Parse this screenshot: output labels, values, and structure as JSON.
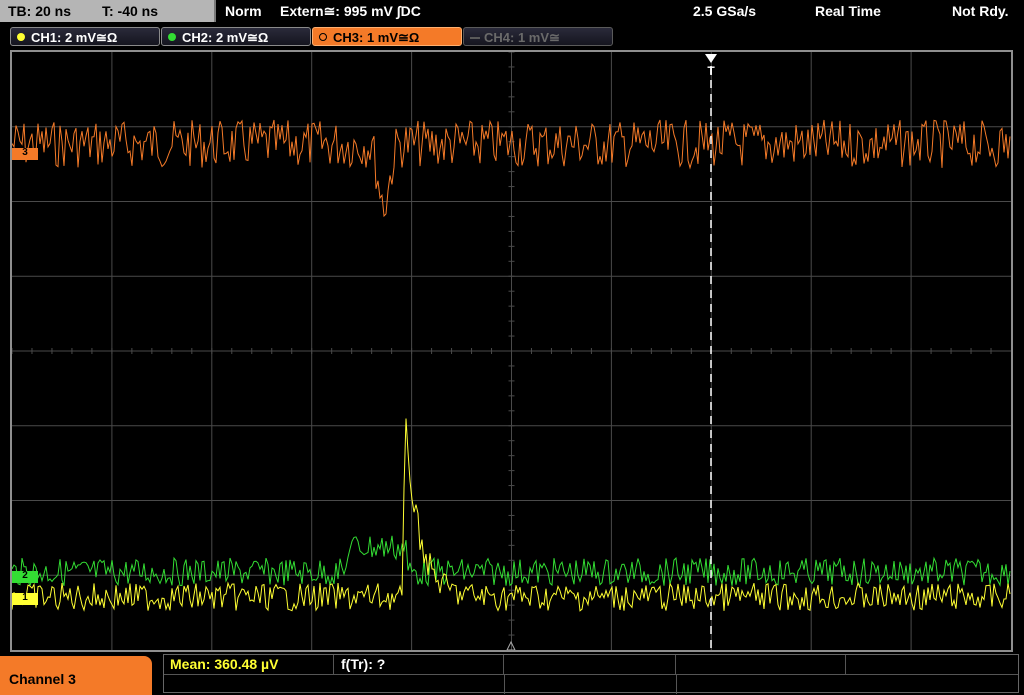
{
  "topbar": {
    "timebase": "TB: 20 ns",
    "trigger_offset": "T: -40 ns",
    "trigger_mode": "Norm",
    "trigger_source": "Extern≅: 995 mV ∫DC",
    "sample_rate": "2.5 GSa/s",
    "acq_mode": "Real Time",
    "status": "Not Rdy."
  },
  "channels": [
    {
      "label": "CH1: 2 mV≅Ω",
      "color": "#ffff33",
      "state": "on"
    },
    {
      "label": "CH2: 2 mV≅Ω",
      "color": "#33dd33",
      "state": "on"
    },
    {
      "label": "CH3: 1 mV≅Ω",
      "color": "#f47a28",
      "state": "active"
    },
    {
      "label": "CH4: 1 mV≅",
      "color": "#5a5a5a",
      "state": "off"
    }
  ],
  "markers": {
    "ch3": "3",
    "ch2": "2",
    "ch1": "1",
    "trigger": "T"
  },
  "bottom": {
    "active_channel": "Channel 3",
    "measurement_1": "Mean: 360.48 µV",
    "measurement_2": "f(Tr): ?"
  },
  "colors": {
    "ch1": "#ffff33",
    "ch2": "#33dd33",
    "ch3": "#f47a28",
    "grid": "#4a4a4a",
    "accent": "#f47a28"
  }
}
